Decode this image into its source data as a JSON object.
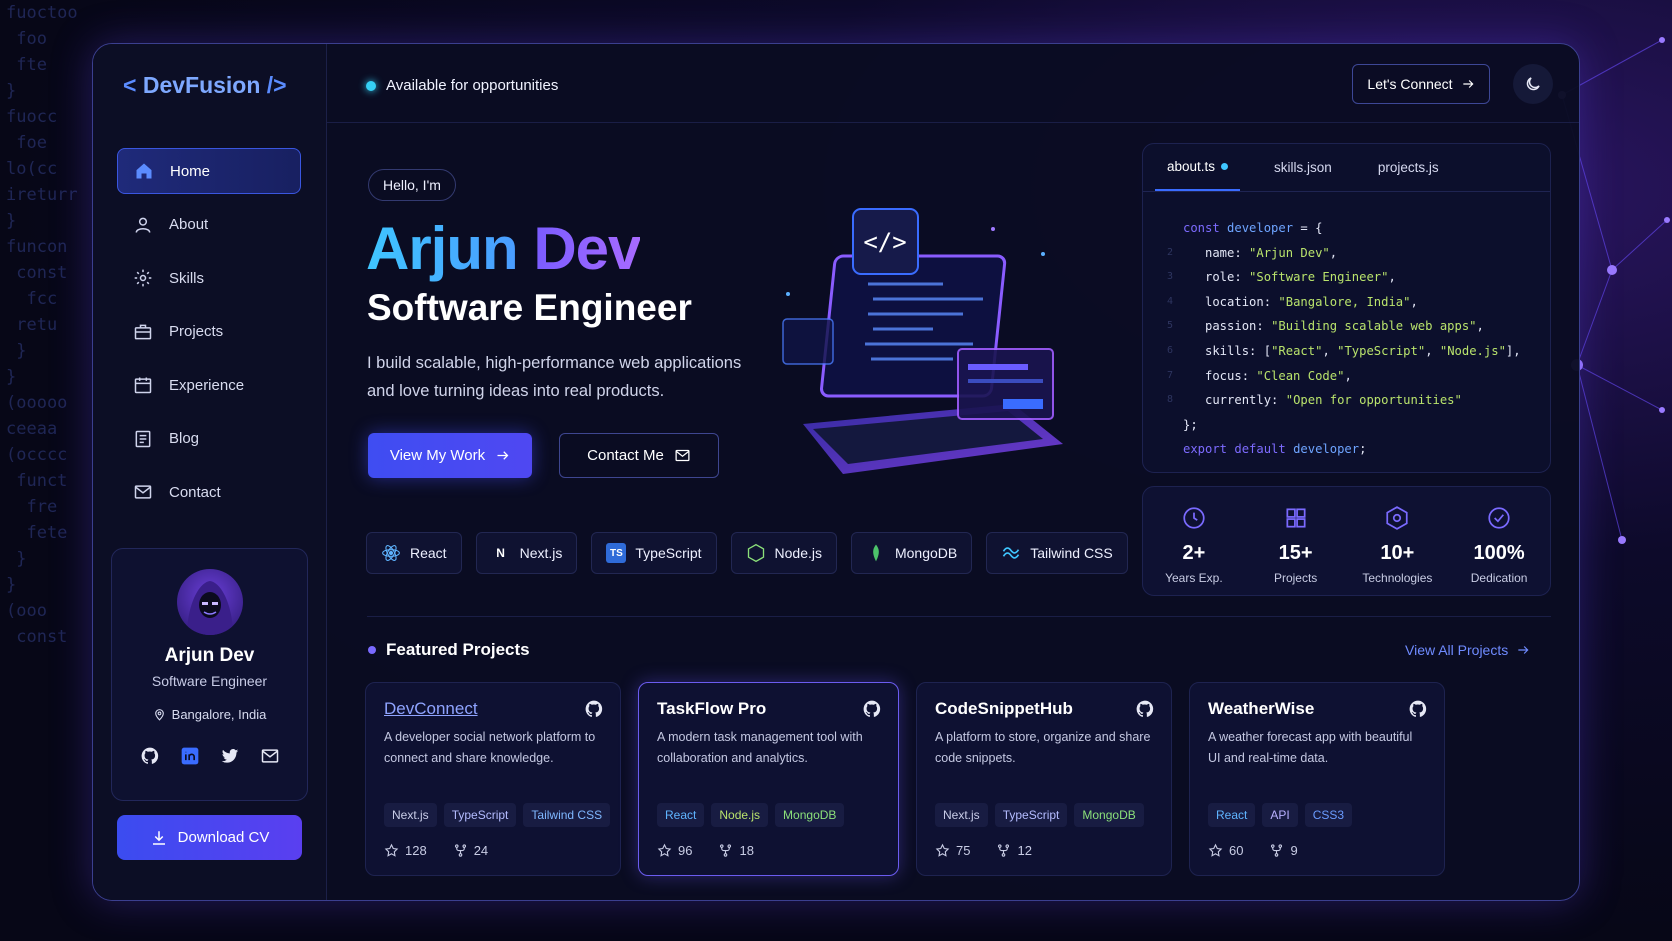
{
  "brand": {
    "open": "<",
    "name": "DevFusion",
    "close": "/>"
  },
  "sidebar": {
    "items": [
      {
        "label": "Home",
        "icon": "home-icon",
        "active": true
      },
      {
        "label": "About",
        "icon": "user-icon"
      },
      {
        "label": "Skills",
        "icon": "gear-icon"
      },
      {
        "label": "Projects",
        "icon": "briefcase-icon"
      },
      {
        "label": "Experience",
        "icon": "calendar-icon"
      },
      {
        "label": "Blog",
        "icon": "document-icon"
      },
      {
        "label": "Contact",
        "icon": "mail-icon"
      }
    ],
    "profile": {
      "name": "Arjun Dev",
      "role": "Software Engineer",
      "location": "Bangalore, India"
    },
    "download_label": "Download CV"
  },
  "header": {
    "availability": "Available for opportunities",
    "connect_label": "Let's Connect"
  },
  "hero": {
    "greeting": "Hello, I'm",
    "first_name": "Arjun",
    "last_name": "Dev",
    "role": "Software Engineer",
    "description": "I build scalable, high-performance web applications and love turning ideas into real products.",
    "primary_cta": "View My Work",
    "secondary_cta": "Contact Me",
    "tech": [
      "React",
      "Next.js",
      "TypeScript",
      "Node.js",
      "MongoDB",
      "Tailwind CSS"
    ]
  },
  "code_panel": {
    "tabs": [
      "about.ts",
      "skills.json",
      "projects.js"
    ],
    "active_tab": "about.ts",
    "line_numbers": [
      "2",
      "3",
      "4",
      "5",
      "6",
      "7",
      "8"
    ]
  },
  "stats": [
    {
      "value": "2+",
      "label": "Years Exp."
    },
    {
      "value": "15+",
      "label": "Projects"
    },
    {
      "value": "10+",
      "label": "Technologies"
    },
    {
      "value": "100%",
      "label": "Dedication"
    }
  ],
  "featured": {
    "title": "Featured Projects",
    "view_all": "View All Projects",
    "projects": [
      {
        "name": "DevConnect",
        "desc": "A developer social network platform to connect and share knowledge.",
        "tags": [
          "Next.js",
          "TypeScript",
          "Tailwind CSS"
        ],
        "stars": "128",
        "forks": "24"
      },
      {
        "name": "TaskFlow Pro",
        "desc": "A modern task management tool with collaboration and analytics.",
        "tags": [
          "React",
          "Node.js",
          "MongoDB"
        ],
        "stars": "96",
        "forks": "18"
      },
      {
        "name": "CodeSnippetHub",
        "desc": "A platform to store, organize and share code snippets.",
        "tags": [
          "Next.js",
          "TypeScript",
          "MongoDB"
        ],
        "stars": "75",
        "forks": "12"
      },
      {
        "name": "WeatherWise",
        "desc": "A weather forecast app with beautiful UI and real-time data.",
        "tags": [
          "React",
          "API",
          "CSS3"
        ],
        "stars": "60",
        "forks": "9"
      }
    ]
  },
  "colors": {
    "accent": "#4f48f2",
    "cyan": "#3fc6ff",
    "purple": "#7a5cff",
    "background": "#0a0c22"
  }
}
